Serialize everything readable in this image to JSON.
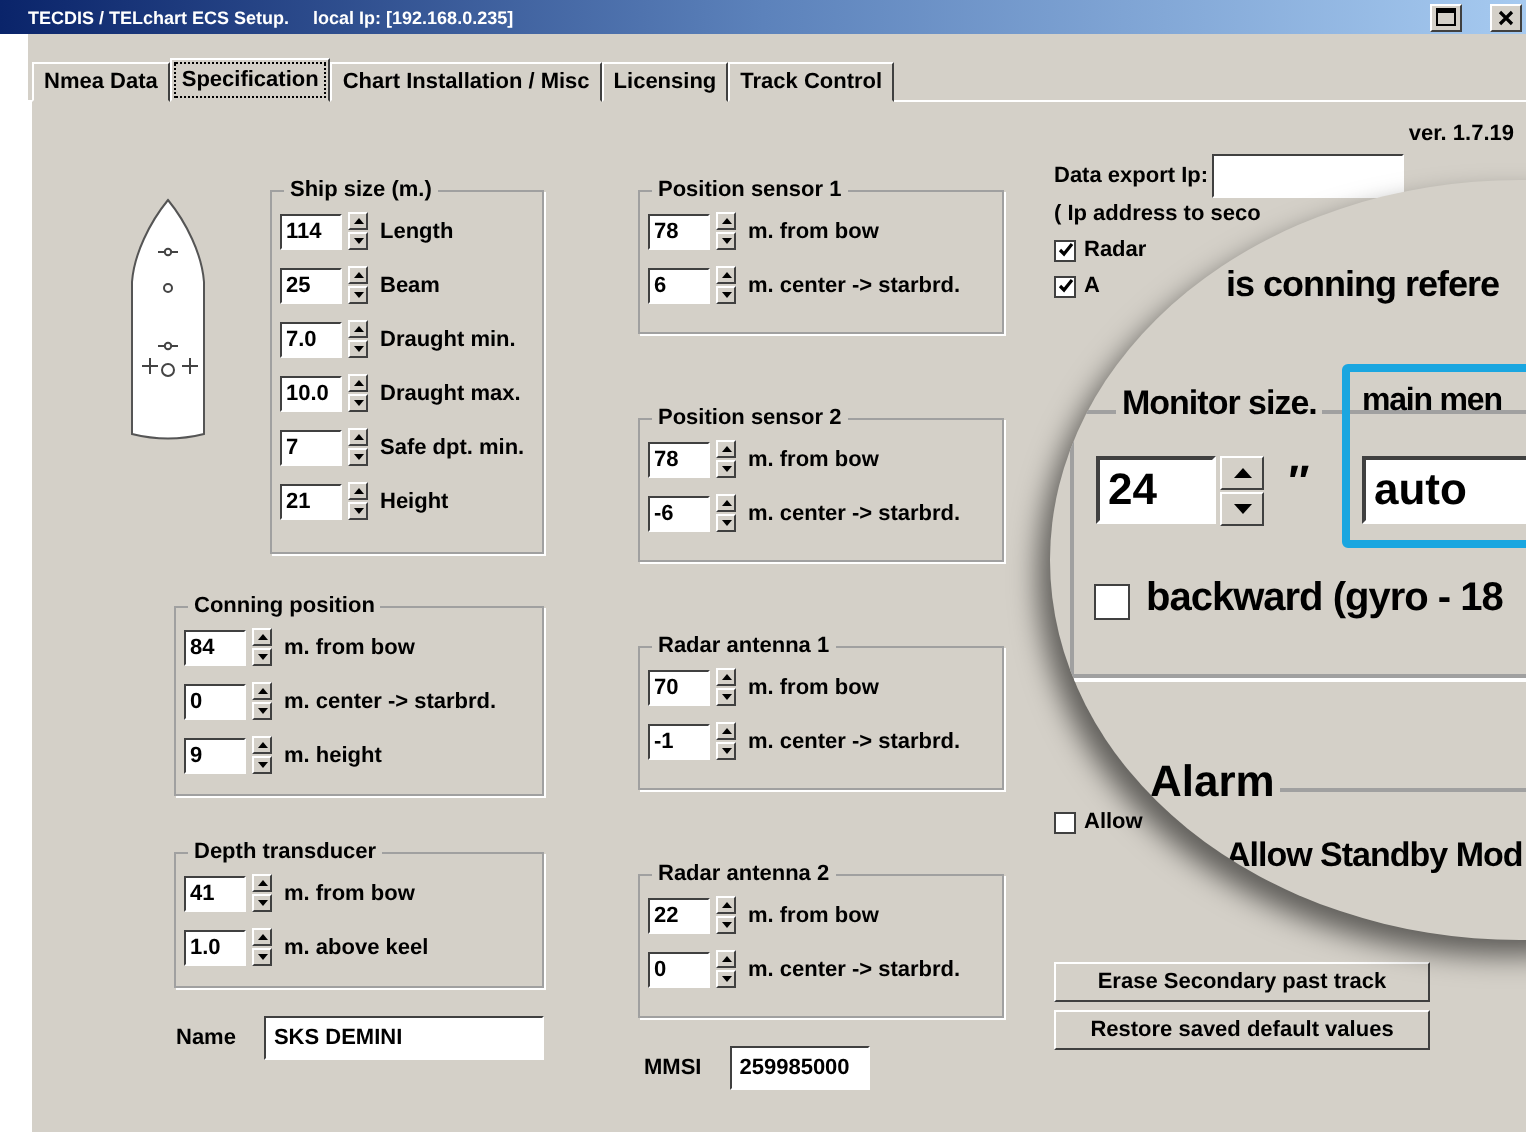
{
  "window": {
    "title": "TECDIS / TELchart ECS Setup.",
    "local_ip": "local Ip: [192.168.0.235]"
  },
  "tabs": [
    {
      "label": "Nmea Data",
      "selected": false
    },
    {
      "label": "Specification",
      "selected": true
    },
    {
      "label": "Chart Installation / Misc",
      "selected": false
    },
    {
      "label": "Licensing",
      "selected": false
    },
    {
      "label": "Track Control",
      "selected": false
    }
  ],
  "version": "ver. 1.7.19",
  "ship_size": {
    "title": "Ship size (m.)",
    "rows": [
      {
        "value": "114",
        "label": "Length"
      },
      {
        "value": "25",
        "label": "Beam"
      },
      {
        "value": "7.0",
        "label": "Draught min."
      },
      {
        "value": "10.0",
        "label": "Draught max."
      },
      {
        "value": "7",
        "label": "Safe dpt. min."
      },
      {
        "value": "21",
        "label": "Height"
      }
    ]
  },
  "left_groups": [
    {
      "title": "Conning position",
      "rows": [
        {
          "value": "84",
          "label": "m. from bow"
        },
        {
          "value": "0",
          "label": "m. center -> starbrd."
        },
        {
          "value": "9",
          "label": "m. height"
        }
      ]
    },
    {
      "title": "Depth transducer",
      "rows": [
        {
          "value": "41",
          "label": "m. from bow"
        },
        {
          "value": "1.0",
          "label": "m. above keel"
        }
      ]
    }
  ],
  "middle_groups": [
    {
      "title": "Position sensor 1",
      "rows": [
        {
          "value": "78",
          "label": "m. from bow"
        },
        {
          "value": "6",
          "label": "m. center -> starbrd."
        }
      ]
    },
    {
      "title": "Position sensor 2",
      "rows": [
        {
          "value": "78",
          "label": "m. from bow"
        },
        {
          "value": "-6",
          "label": "m. center -> starbrd."
        }
      ]
    },
    {
      "title": "Radar antenna 1",
      "rows": [
        {
          "value": "70",
          "label": "m. from bow"
        },
        {
          "value": "-1",
          "label": "m. center -> starbrd."
        }
      ]
    },
    {
      "title": "Radar antenna 2",
      "rows": [
        {
          "value": "22",
          "label": "m. from bow"
        },
        {
          "value": "0",
          "label": "m. center -> starbrd."
        }
      ]
    }
  ],
  "name": {
    "label": "Name",
    "value": "SKS DEMINI"
  },
  "mmsi": {
    "label": "MMSI",
    "value": "259985000"
  },
  "data_export": {
    "label": "Data export Ip:",
    "hint": "( Ip address to seco"
  },
  "checkboxes": [
    {
      "label": "Radar",
      "checked": true
    },
    {
      "label": "A",
      "checked": true
    }
  ],
  "alarm_checkbox": {
    "label": "Allow",
    "checked": false
  },
  "magnifier": {
    "heading": "is conning refere",
    "monitor_label": "Monitor size.",
    "monitor_value": "24",
    "unit": "″",
    "menu_label": "main men",
    "menu_value": "auto",
    "backward": {
      "label": "backward (gyro - 18",
      "checked": false
    },
    "alarm_title": "Alarm",
    "standby_label": "Allow Standby Mod"
  },
  "buttons": [
    "Erase Secondary past track",
    "Restore saved default values"
  ]
}
